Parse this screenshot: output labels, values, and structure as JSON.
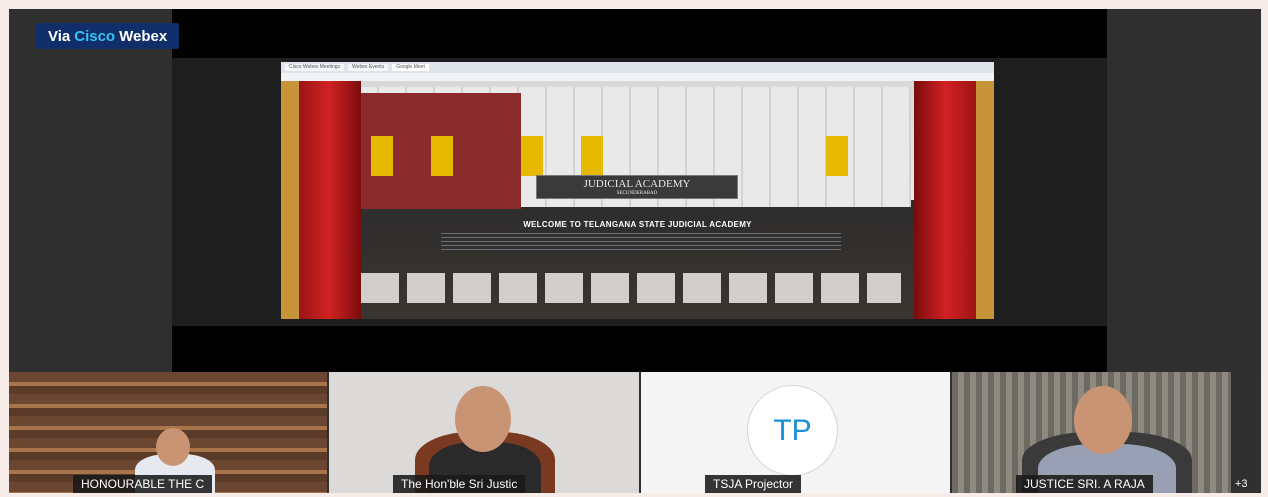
{
  "brand": {
    "prefix": "Via ",
    "name_accent": "Cisco",
    "name_rest": "Webex"
  },
  "share": {
    "browser_tabs": [
      "Cisco Webex Meetings",
      "Webex Events",
      "Google Meet"
    ],
    "sign_title": "JUDICIAL ACADEMY",
    "sign_subtitle": "SECUNDERABAD",
    "welcome_heading": "WELCOME TO TELANGANA STATE JUDICIAL ACADEMY"
  },
  "participants": [
    {
      "label": "HONOURABLE THE C"
    },
    {
      "label": "The Hon'ble Sri Justic"
    },
    {
      "label": "TSJA Projector",
      "initials": "TP"
    },
    {
      "label": "JUSTICE SRI. A RAJA"
    }
  ],
  "overflow": {
    "label": "+3"
  }
}
